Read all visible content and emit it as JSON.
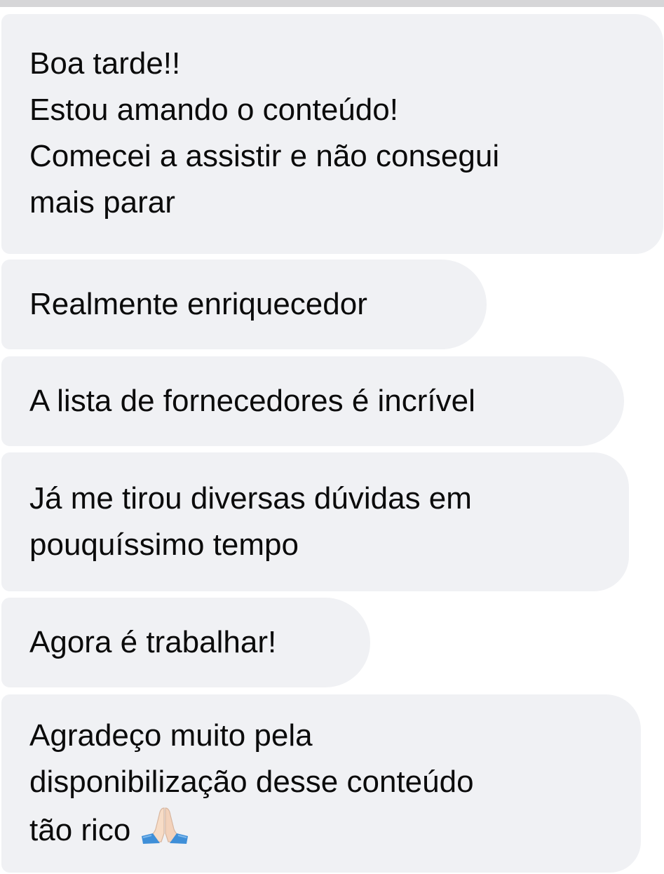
{
  "chat": {
    "messages": [
      {
        "lines": [
          "Boa tarde!!",
          "Estou amando o conteúdo!",
          "Comecei a assistir e não consegui",
          "mais parar"
        ]
      },
      {
        "lines": [
          "Realmente enriquecedor"
        ]
      },
      {
        "lines": [
          "A lista de fornecedores é incrível"
        ]
      },
      {
        "lines": [
          "Já me tirou diversas dúvidas em",
          "pouquíssimo tempo"
        ]
      },
      {
        "lines": [
          "Agora é trabalhar!"
        ]
      },
      {
        "lines": [
          "Agradeço muito pela",
          "disponibilização desse conteúdo",
          "tão rico"
        ],
        "emoji": "folded-hands-icon"
      }
    ]
  },
  "colors": {
    "bubble_background": "#f0f1f4",
    "text": "#0b0b0b",
    "top_bar": "#d6d6d8"
  }
}
